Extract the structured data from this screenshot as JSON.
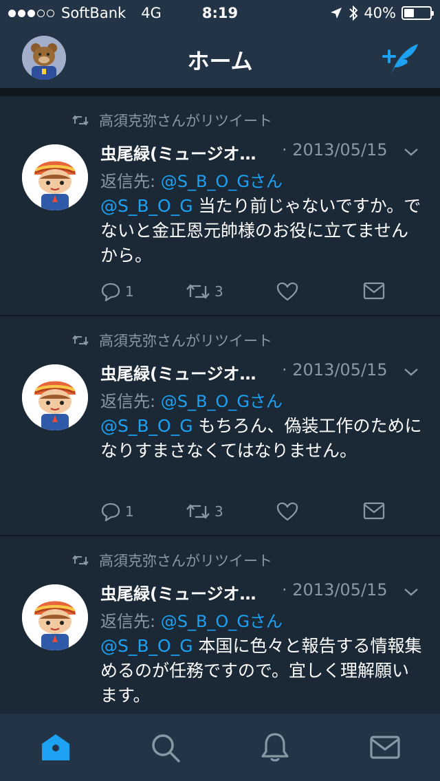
{
  "status_bar": {
    "signal_dots_filled": 3,
    "signal_dots_total": 5,
    "carrier": "SoftBank",
    "network": "4G",
    "time": "8:19",
    "battery": "40%",
    "battery_level": 0.4
  },
  "header": {
    "title": "ホーム",
    "compose_icon": "compose-tweet-icon",
    "avatar_icon": "profile-avatar"
  },
  "tweets": [
    {
      "retweeted_by": "高須克弥さんがリツイート",
      "name": "虫尾緑(ミュージオ…",
      "date": "· 2013/05/15",
      "reply_prefix": "返信先:",
      "reply_to": "@S_B_O_Gさん",
      "mention": "@S_B_O_G",
      "text": "当たり前じゃないですか。でないと金正恩元帥様のお役に立てませんから。",
      "reply_count": "1",
      "retweet_count": "3"
    },
    {
      "retweeted_by": "高須克弥さんがリツイート",
      "name": "虫尾緑(ミュージオ…",
      "date": "· 2013/05/15",
      "reply_prefix": "返信先:",
      "reply_to": "@S_B_O_Gさん",
      "mention": "@S_B_O_G",
      "text": "もちろん、偽装工作のためになりすまさなくてはなりません。",
      "reply_count": "1",
      "retweet_count": "3"
    },
    {
      "retweeted_by": "高須克弥さんがリツイート",
      "name": "虫尾緑(ミュージオ…",
      "date": "· 2013/05/15",
      "reply_prefix": "返信先:",
      "reply_to": "@S_B_O_Gさん",
      "mention": "@S_B_O_G",
      "text": "本国に色々と報告する情報集めるのが任務ですので。宜しく理解願います。",
      "reply_count": "",
      "retweet_count": ""
    }
  ],
  "tabbar": {
    "tabs": [
      "home-icon",
      "search-icon",
      "notifications-icon",
      "messages-icon"
    ],
    "active": "home-icon"
  },
  "colors": {
    "bar_bg": "#243447",
    "card_bg": "#1b2836",
    "separator": "#10171e",
    "accent": "#1da1f2",
    "muted": "#8899a6"
  }
}
